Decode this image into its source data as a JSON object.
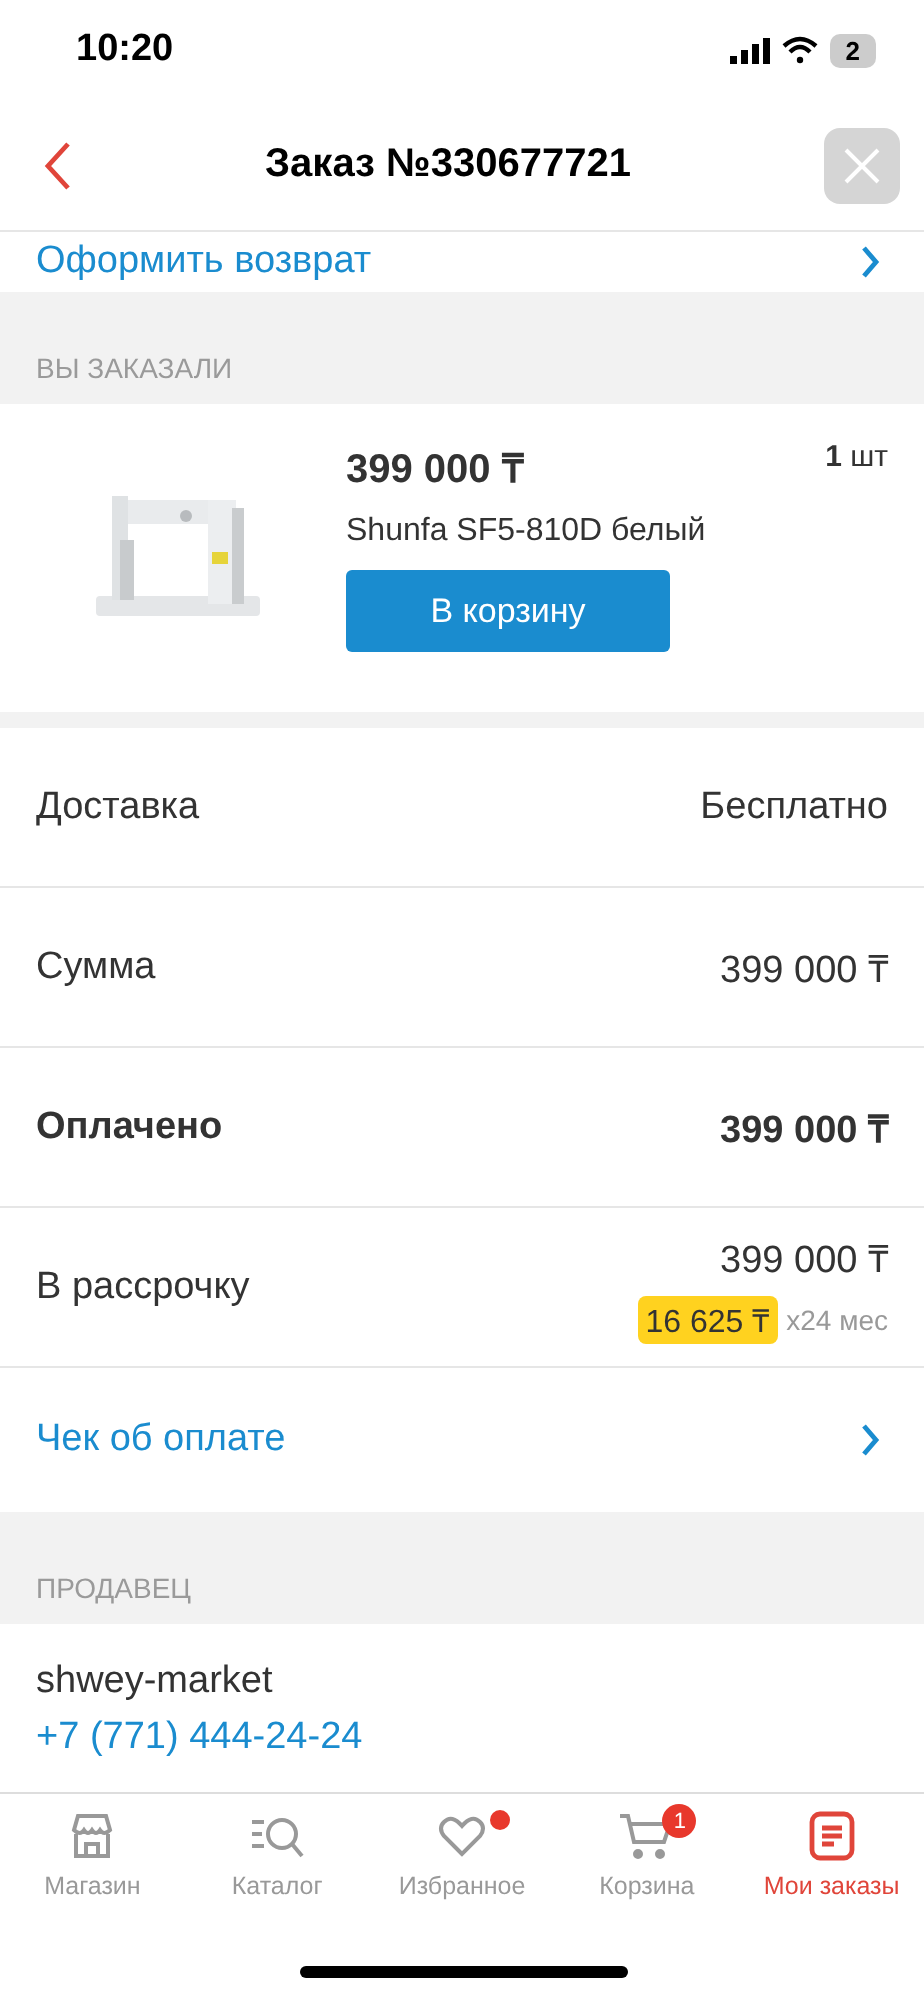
{
  "status_bar": {
    "time": "10:20",
    "battery": "2"
  },
  "header": {
    "title": "Заказ №330677721"
  },
  "return_link": {
    "label": "Оформить возврат"
  },
  "ordered": {
    "heading": "ВЫ ЗАКАЗАЛИ",
    "item": {
      "kind": "picture",
      "price": "399 000 ₸",
      "quantity": "1",
      "unit": "шт",
      "name": "Shunfa SF5-810D белый",
      "button": "В корзину"
    }
  },
  "summary": [
    {
      "kind": "plain",
      "label": "Доставка",
      "value": "Бесплатно"
    },
    {
      "kind": "plain",
      "label": "Сумма",
      "value": "399 000 ₸"
    },
    {
      "kind": "bold",
      "label": "Оплачено",
      "value": "399 000 ₸"
    },
    {
      "kind": "installment",
      "label": "В рассрочку",
      "value": "399 000 ₸",
      "monthly": "16 625 ₸",
      "term": "x24 мес"
    }
  ],
  "receipt_link": {
    "label": "Чек об оплате"
  },
  "seller": {
    "heading": "ПРОДАВЕЦ",
    "name": "shwey-market",
    "phone": "+7 (771) 444-24-24"
  },
  "tab_bar": [
    {
      "kind": "store",
      "label": "Магазин",
      "selected": false,
      "dot": false
    },
    {
      "kind": "catalog",
      "label": "Каталог",
      "selected": false,
      "dot": false
    },
    {
      "kind": "heart",
      "label": "Избранное",
      "selected": false,
      "dot": true
    },
    {
      "kind": "cart",
      "label": "Корзина",
      "selected": false,
      "dot": false,
      "badge": "1"
    },
    {
      "kind": "orders",
      "label": "Мои заказы",
      "selected": true,
      "dot": false
    }
  ]
}
